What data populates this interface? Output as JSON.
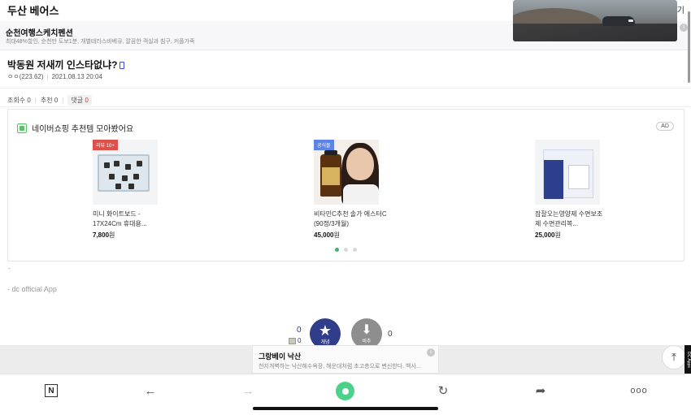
{
  "header": {
    "title": "두산 베어스",
    "right_glyph": "기"
  },
  "top_ad": {
    "name": "순천여행스케치펜션",
    "desc": "최대48%할인, 순천만 도보1분, 개별테라스바베큐, 깔끔한 객실과 침구, 커플가족",
    "info": "i"
  },
  "post": {
    "title": "박동원 저새끼 인스타없냐?",
    "author": "ㅇㅇ(223.62)",
    "date": "2021.08.13 20:04",
    "stats": {
      "views_label": "조회수",
      "views": "0",
      "recommend_label": "추천",
      "recommend": "0",
      "comments_label": "댓글",
      "comments": "0"
    }
  },
  "shopping": {
    "title": "네이버쇼핑 추천템 모아봤어요",
    "ad_label": "AD",
    "products": [
      {
        "badge": "리뷰 10+",
        "name": "미니 화이트보드 - 17X24Cm 휴대용...",
        "price": "7,800",
        "unit": "원"
      },
      {
        "badge": "공식몰",
        "name": "비타민C추천 솔가 에스터C (90정/3개월)",
        "price": "45,000",
        "unit": "원"
      },
      {
        "badge": "",
        "name": "잠잘오는영양제 수면보조제 수면관리복...",
        "price": "25,000",
        "unit": "원"
      }
    ]
  },
  "body": {
    "dash": "-",
    "signature": "- dc official App"
  },
  "recommend": {
    "count": "0",
    "fixed_count": "0",
    "recommend_label": "개념",
    "not_count": "0",
    "not_label": "비추"
  },
  "bottom_ad": {
    "name": "그랑베이 낙산",
    "desc": "천지개벽하는 낙산해수욕장, 해운대처럼 초고층으로 변신한다. 백사...",
    "info": "i"
  },
  "side_tab": "DC Apps",
  "colors": {
    "accent": "#2f3d8b",
    "home": "#4cd18a",
    "badge_red": "#e0504a",
    "badge_blue": "#5c83e6"
  },
  "toolbar": {
    "icons": [
      "naver-n-icon",
      "back-arrow-icon",
      "forward-arrow-icon",
      "home-icon",
      "refresh-icon",
      "share-icon",
      "more-icon"
    ]
  }
}
